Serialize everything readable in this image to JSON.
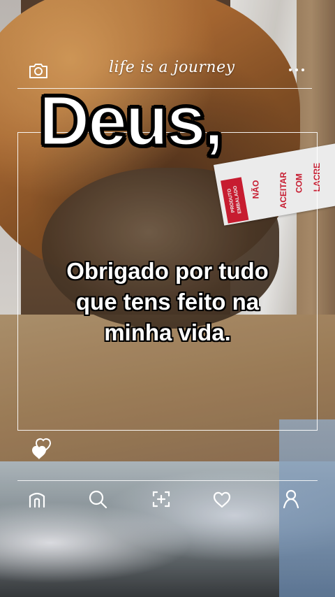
{
  "header": {
    "tagline": "life is a journey",
    "camera_icon": "camera-icon",
    "menu_icon": "more-dots-icon"
  },
  "post": {
    "headline": "Deus,",
    "message_lines": [
      "Obrigado por tudo",
      "que tens feito na",
      "minha vida."
    ]
  },
  "photo_label": {
    "stamp": "PRODUTO EMBALADO",
    "words": [
      "NÃO",
      "ACEITAR",
      "COM",
      "LACRE"
    ]
  },
  "like": {
    "icon": "hearts-icon"
  },
  "nav": {
    "items": [
      {
        "name": "home",
        "icon": "home-icon"
      },
      {
        "name": "search",
        "icon": "search-icon"
      },
      {
        "name": "add",
        "icon": "add-post-icon"
      },
      {
        "name": "activity",
        "icon": "heart-icon"
      },
      {
        "name": "profile",
        "icon": "profile-icon"
      }
    ]
  },
  "colors": {
    "overlay_line": "#ffffff",
    "label_red": "#d81f35",
    "text": "#ffffff",
    "outline": "#000000"
  }
}
